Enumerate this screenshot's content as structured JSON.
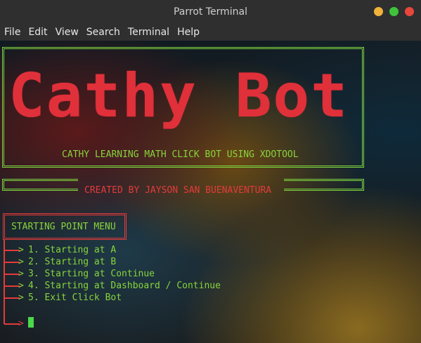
{
  "window": {
    "title": "Parrot Terminal"
  },
  "colors": {
    "close": "#f0a33b",
    "min": "#3ec33b",
    "max": "#e8463b"
  },
  "menu": [
    "File",
    "Edit",
    "View",
    "Search",
    "Terminal",
    "Help"
  ],
  "banner": {
    "logo_text": "Cathy Bot",
    "subtitle": "CATHY LEARNING MATH CLICK BOT USING XDOTOOL",
    "credit": "CREATED BY JAYSON SAN BUENAVENTURA"
  },
  "menu_box": {
    "title": "STARTING POINT MENU"
  },
  "options": [
    "1. Starting at A",
    "2. Starting at B",
    "3. Starting at Continue",
    "4. Starting at Dashboard / Continue",
    "5. Exit Click Bot"
  ]
}
